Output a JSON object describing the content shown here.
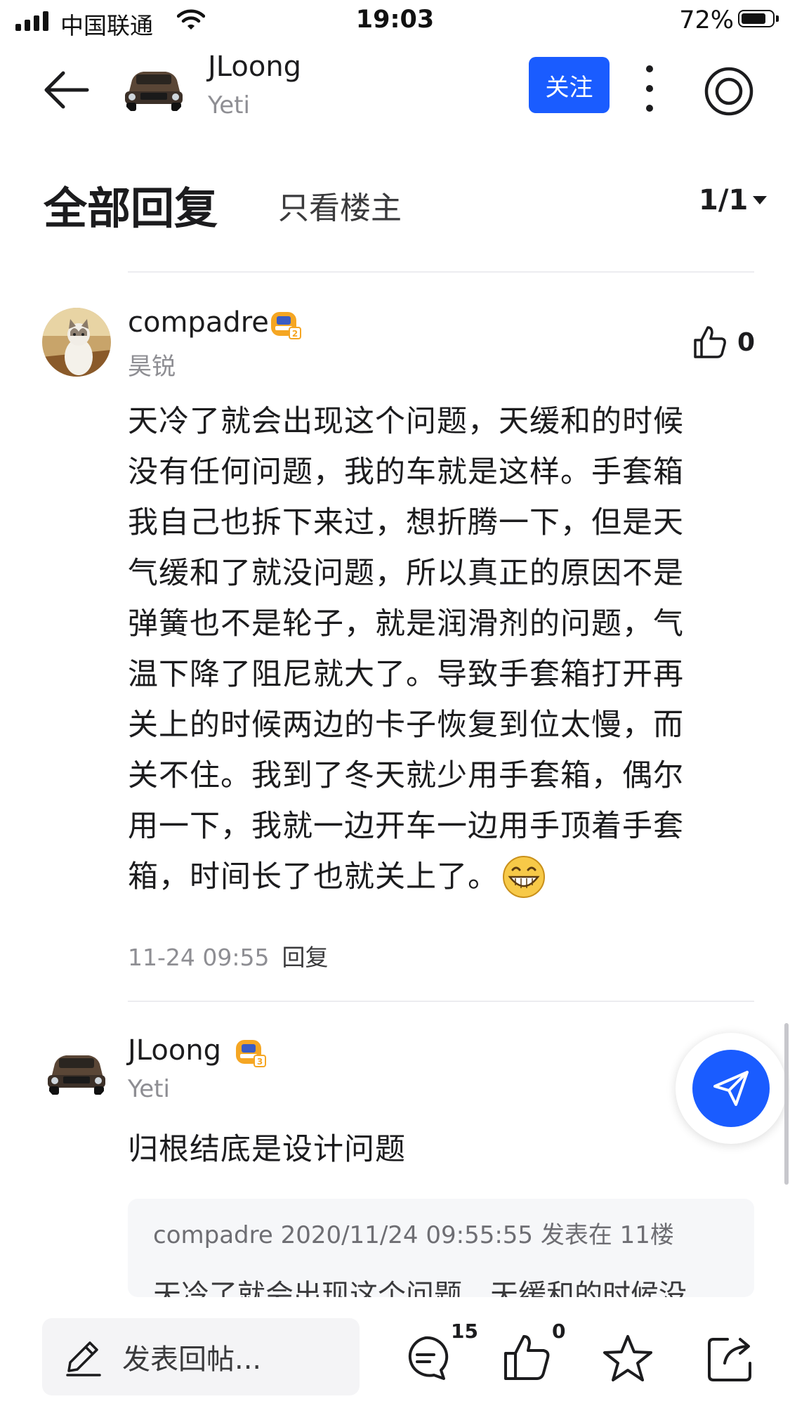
{
  "status_bar": {
    "carrier": "中国联通",
    "time": "19:03",
    "battery": "72%"
  },
  "header": {
    "author_name": "JLoong",
    "author_sub": "Yeti",
    "follow_label": "关注"
  },
  "tabs": {
    "all_replies": "全部回复",
    "host_only": "只看楼主",
    "page": "1/1"
  },
  "replies": [
    {
      "user": "compadre",
      "sub": "昊锐",
      "badge_level": "2",
      "likes": "0",
      "lines": [
        "天冷了就会出现这个问题，天缓和的时候",
        "没有任何问题，我的车就是这样。手套箱",
        "我自己也拆下来过，想折腾一下，但是天",
        "气缓和了就没问题，所以真正的原因不是",
        "弹簧也不是轮子，就是润滑剂的问题，气",
        "温下降了阻尼就大了。导致手套箱打开再",
        "关上的时候两边的卡子恢复到位太慢，而",
        "关不住。我到了冬天就少用手套箱，偶尔",
        "用一下，我就一边开车一边用手顶着手套",
        "箱，时间长了也就关上了。"
      ],
      "emoji": "grinning-emoji",
      "time": "11-24 09:55",
      "reply_label": "回复"
    },
    {
      "user": "JLoong",
      "sub": "Yeti",
      "badge_level": "3",
      "text": "归根结底是设计问题",
      "quote_header": "compadre 2020/11/24 09:55:55 发表在 11楼",
      "quote_text": "天冷了就会出现这个问题，天缓和的时候没"
    }
  ],
  "bottom_bar": {
    "compose_placeholder": "发表回帖...",
    "comment_count": "15",
    "like_count": "0"
  },
  "colors": {
    "accent": "#1a5cff",
    "badge": "#f5a623"
  }
}
